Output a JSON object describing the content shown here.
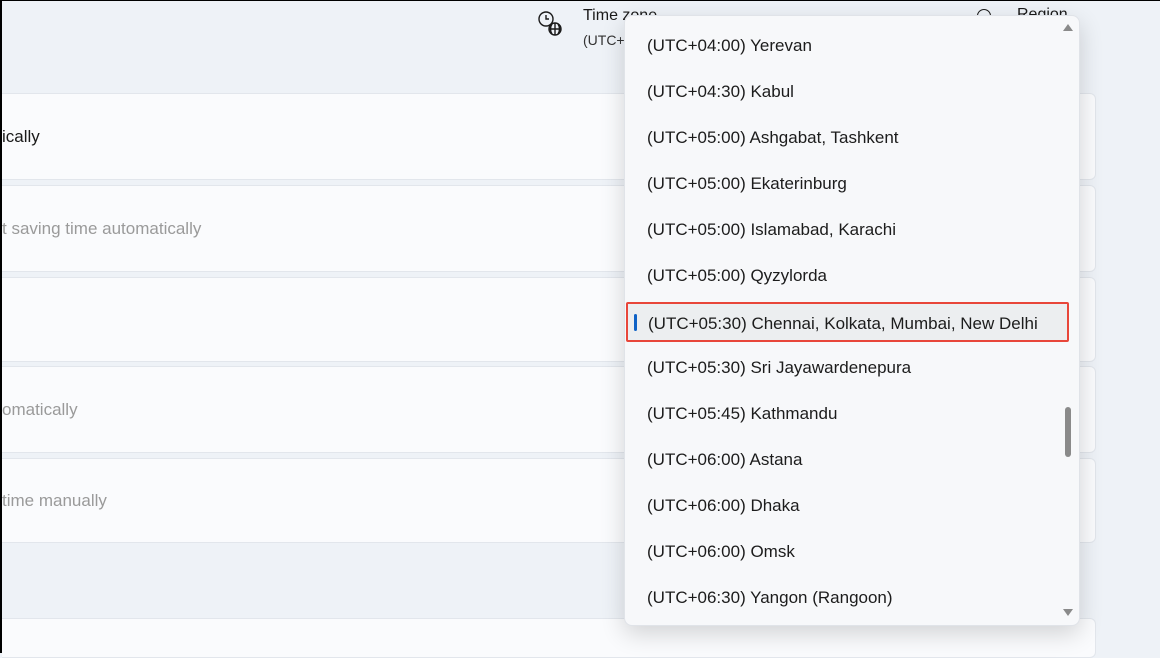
{
  "header": {
    "timezone_label": "Time zone",
    "timezone_value": "(UTC+",
    "region_label": "Region"
  },
  "settings_rows": [
    {
      "label": "ically",
      "disabled": false
    },
    {
      "label": "t saving time automatically",
      "disabled": true
    },
    {
      "label": "",
      "disabled": false
    },
    {
      "label": "omatically",
      "disabled": true
    },
    {
      "label": "time manually",
      "disabled": true
    }
  ],
  "dropdown": {
    "items": [
      "(UTC+04:00) Yerevan",
      "(UTC+04:30) Kabul",
      "(UTC+05:00) Ashgabat, Tashkent",
      "(UTC+05:00) Ekaterinburg",
      "(UTC+05:00) Islamabad, Karachi",
      "(UTC+05:00) Qyzylorda",
      "(UTC+05:30) Chennai, Kolkata, Mumbai, New Delhi",
      "(UTC+05:30) Sri Jayawardenepura",
      "(UTC+05:45) Kathmandu",
      "(UTC+06:00) Astana",
      "(UTC+06:00) Dhaka",
      "(UTC+06:00) Omsk",
      "(UTC+06:30) Yangon (Rangoon)"
    ],
    "selected_index": 6
  },
  "colors": {
    "accent": "#0f62c6",
    "highlight_border": "#e8463a"
  }
}
